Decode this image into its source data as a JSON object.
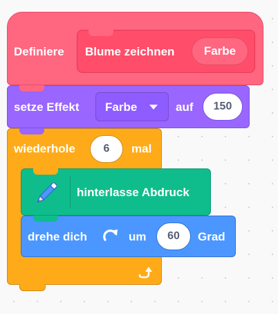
{
  "define_block": {
    "keyword": "Definiere",
    "name": "Blume zeichnen",
    "param": "Farbe"
  },
  "effect_block": {
    "label": "setze Effekt",
    "dropdown": "Farbe",
    "mid": "auf",
    "value": "150"
  },
  "repeat_block": {
    "label": "wiederhole",
    "count": "6",
    "suffix": "mal"
  },
  "pen_block": {
    "label": "hinterlasse Abdruck"
  },
  "turn_block": {
    "label": "drehe dich",
    "mid": "um",
    "value": "60",
    "suffix": "Grad"
  },
  "colors": {
    "define": "#ff6680",
    "define_inner": "#ff4d6a",
    "looks": "#9966ff",
    "control": "#ffab19",
    "pen": "#0fbd8c",
    "motion": "#4c97ff"
  }
}
